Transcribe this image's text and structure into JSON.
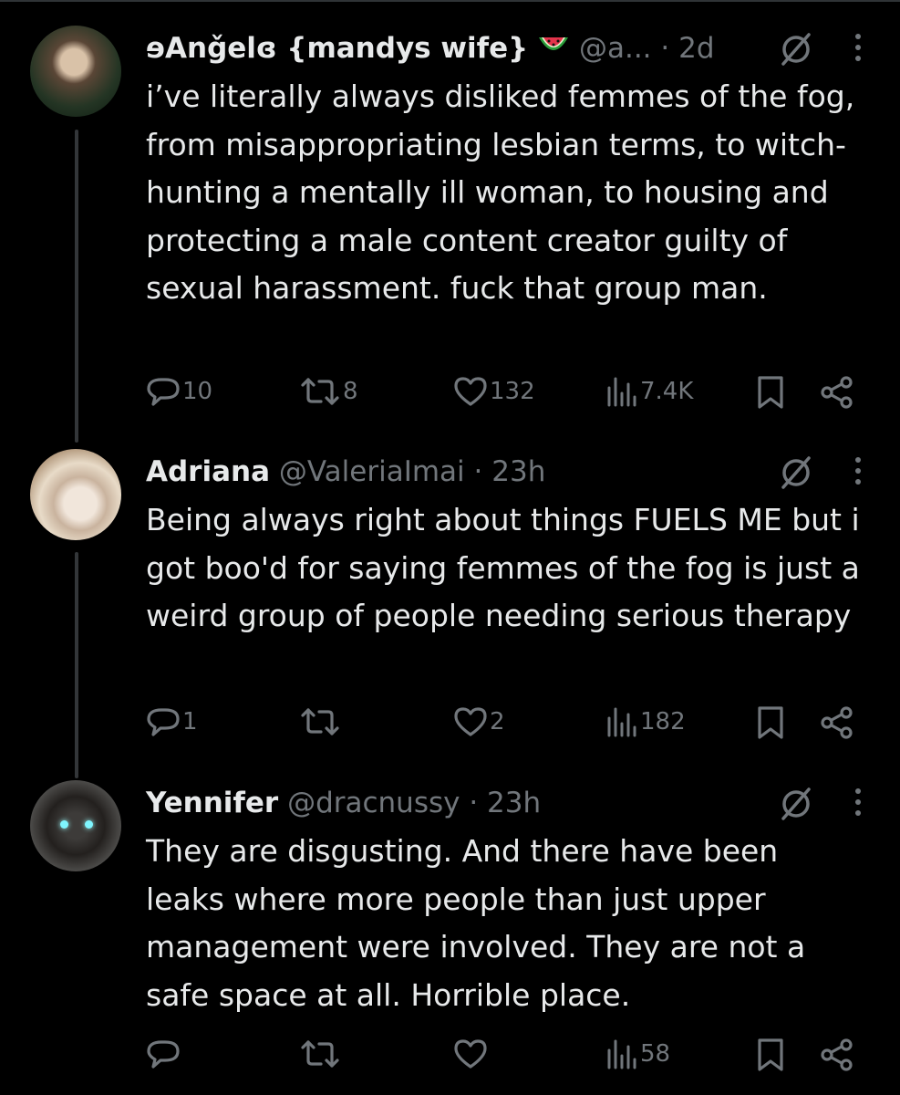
{
  "tweets": [
    {
      "name": "ɘAnǧelɞ {mandys wife}",
      "handle": "@a...",
      "time": "2d",
      "body": "i’ve literally always disliked femmes of the fog, from misappropriating lesbian terms, to witch-hunting a mentally ill woman, to housing and protecting a male content creator guilty of sexual harassment. fuck that group man.",
      "replies": "10",
      "reposts": "8",
      "likes": "132",
      "views": "7.4K"
    },
    {
      "name": "Adriana",
      "handle": "@ValeriaImai",
      "time": "23h",
      "body": "Being always right about things FUELS ME but i got boo'd for saying femmes of the fog is just a weird group of people needing serious therapy",
      "replies": "1",
      "reposts": "",
      "likes": "2",
      "views": "182"
    },
    {
      "name": "Yennifer",
      "handle": "@dracnussy",
      "time": "23h",
      "body": "They are disgusting. And there have been leaks where more people than just upper management were involved. They are not a safe space at all. Horrible place.",
      "replies": "",
      "reposts": "",
      "likes": "",
      "views": "58"
    }
  ],
  "separator": "·",
  "icons": {
    "emoji": "watermelon-emoji",
    "grok": "grok-icon",
    "more": "more-icon",
    "reply": "reply-icon",
    "repost": "repost-icon",
    "like": "like-icon",
    "views": "views-icon",
    "bookmark": "bookmark-icon",
    "share": "share-icon"
  },
  "colors": {
    "background": "#000000",
    "text": "#e7e9ea",
    "muted": "#71767b",
    "thread_line": "#333639"
  }
}
